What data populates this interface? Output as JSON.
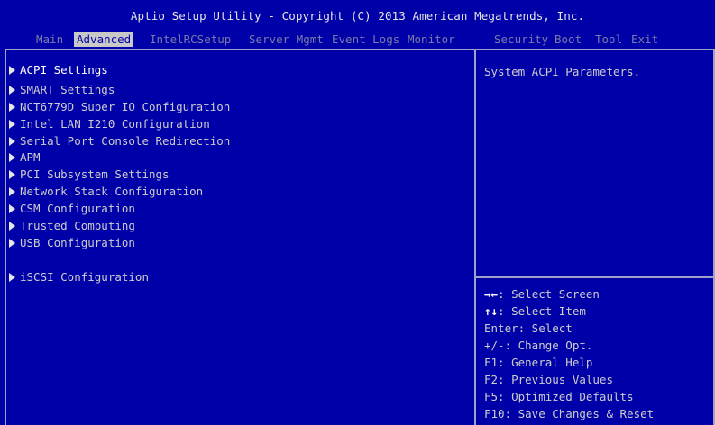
{
  "header": {
    "title": "Aptio Setup Utility - Copyright (C) 2013 American Megatrends, Inc."
  },
  "tabs": [
    {
      "label": "Main"
    },
    {
      "label": "Advanced",
      "active": true
    },
    {
      "label": "IntelRCSetup"
    },
    {
      "label": "Server Mgmt"
    },
    {
      "label": "Event Logs"
    },
    {
      "label": "Monitor"
    },
    {
      "label": "Security"
    },
    {
      "label": "Boot"
    },
    {
      "label": "Tool"
    },
    {
      "label": "Exit"
    }
  ],
  "menu": {
    "items": [
      {
        "label": "ACPI Settings",
        "selected": true
      },
      {
        "label": "SMART Settings"
      },
      {
        "label": "NCT6779D Super IO Configuration"
      },
      {
        "label": "Intel LAN I210 Configuration"
      },
      {
        "label": "Serial Port Console Redirection"
      },
      {
        "label": "APM"
      },
      {
        "label": "PCI Subsystem Settings"
      },
      {
        "label": "Network Stack Configuration"
      },
      {
        "label": "CSM Configuration"
      },
      {
        "label": "Trusted Computing"
      },
      {
        "label": "USB Configuration"
      },
      {
        "label": "iSCSI Configuration"
      }
    ]
  },
  "help": {
    "description": "System ACPI Parameters."
  },
  "keys": [
    {
      "key": "→←",
      "text": ": Select Screen"
    },
    {
      "key": "↑↓",
      "text": ": Select Item"
    },
    {
      "key": "",
      "text": "Enter: Select"
    },
    {
      "key": "",
      "text": "+/-: Change Opt."
    },
    {
      "key": "",
      "text": "F1: General Help"
    },
    {
      "key": "",
      "text": "F2: Previous Values"
    },
    {
      "key": "",
      "text": "F5: Optimized Defaults"
    },
    {
      "key": "",
      "text": "F10: Save Changes & Reset"
    }
  ],
  "colors": {
    "background": "#0000a8",
    "active_tab_bg": "#c8c8c8",
    "inactive_tab_text": "#7a7aa8",
    "frame": "#a0a0c8",
    "text": "#cdcdcd",
    "highlight_text": "#ffffff"
  }
}
